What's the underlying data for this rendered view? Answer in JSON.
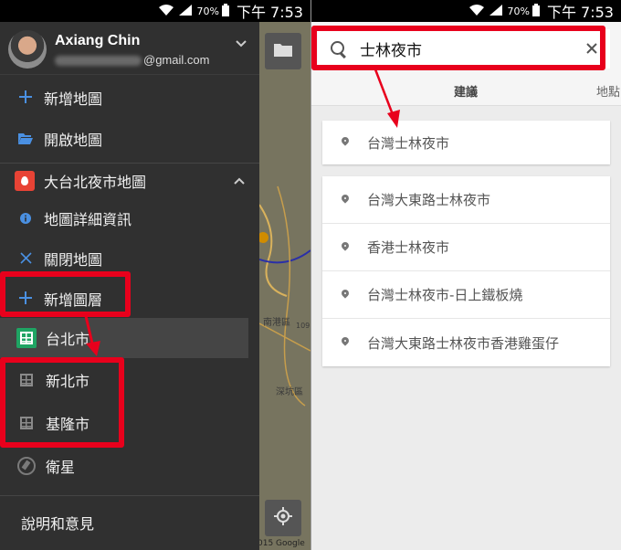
{
  "status_bar": {
    "battery_pct": "70%",
    "time": "下午 7:53"
  },
  "drawer": {
    "account": {
      "name": "Axiang Chin",
      "email_suffix": "@gmail.com"
    },
    "items": {
      "add_map": "新增地圖",
      "open_map": "開啟地圖",
      "map_title": "大台北夜市地圖",
      "map_details": "地圖詳細資訊",
      "close_map": "關閉地圖",
      "add_layer": "新增圖層",
      "layer_taipei": "台北市",
      "layer_new_taipei": "新北市",
      "layer_keelung": "基隆市",
      "satellite": "衛星"
    },
    "help": "說明和意見"
  },
  "map": {
    "labels": {
      "nangang": "南港區",
      "num": "109",
      "shenkeng": "深坑區"
    },
    "copyright": "015 Google"
  },
  "search": {
    "query": "士林夜市",
    "tabs": {
      "suggest": "建議",
      "places": "地點"
    },
    "top_result": "台灣士林夜市",
    "results": [
      "台灣大東路士林夜市",
      "香港士林夜市",
      "台灣士林夜市-日上鐵板燒",
      "台灣大東路士林夜市香港雞蛋仔"
    ]
  }
}
